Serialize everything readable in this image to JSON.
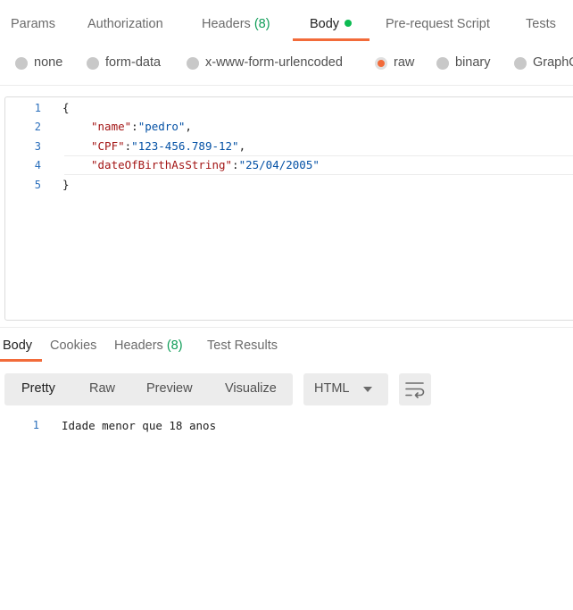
{
  "request_tabs": {
    "params": "Params",
    "authorization": "Authorization",
    "headers": "Headers",
    "headers_count": "(8)",
    "body": "Body",
    "prerequest": "Pre-request Script",
    "tests": "Tests"
  },
  "body_types": {
    "none": "none",
    "form_data": "form-data",
    "urlencoded": "x-www-form-urlencoded",
    "raw": "raw",
    "binary": "binary",
    "graphql": "GraphQ",
    "selected": "raw"
  },
  "editor": {
    "line_numbers": [
      "1",
      "2",
      "3",
      "4",
      "5"
    ],
    "open_brace": "{",
    "close_brace": "}",
    "fields": [
      {
        "key": "\"name\"",
        "value": "\"pedro\"",
        "trail": ","
      },
      {
        "key": "\"CPF\"",
        "value": "\"123-456.789-12\"",
        "trail": ","
      },
      {
        "key": "\"dateOfBirthAsString\"",
        "value": "\"25/04/2005\"",
        "trail": ""
      }
    ],
    "colon": ":"
  },
  "response_tabs": {
    "body": "Body",
    "cookies": "Cookies",
    "headers": "Headers",
    "headers_count": "(8)",
    "test_results": "Test Results"
  },
  "response_view": {
    "pretty": "Pretty",
    "raw": "Raw",
    "preview": "Preview",
    "visualize": "Visualize",
    "format": "HTML"
  },
  "response_body": {
    "line_number": "1",
    "text": "Idade menor que 18 anos"
  },
  "colors": {
    "accent": "#f26b3a",
    "status_green": "#0cbb52"
  },
  "icons": {
    "wrap": "wrap-lines-icon",
    "format_caret": "chevron-down-icon"
  }
}
